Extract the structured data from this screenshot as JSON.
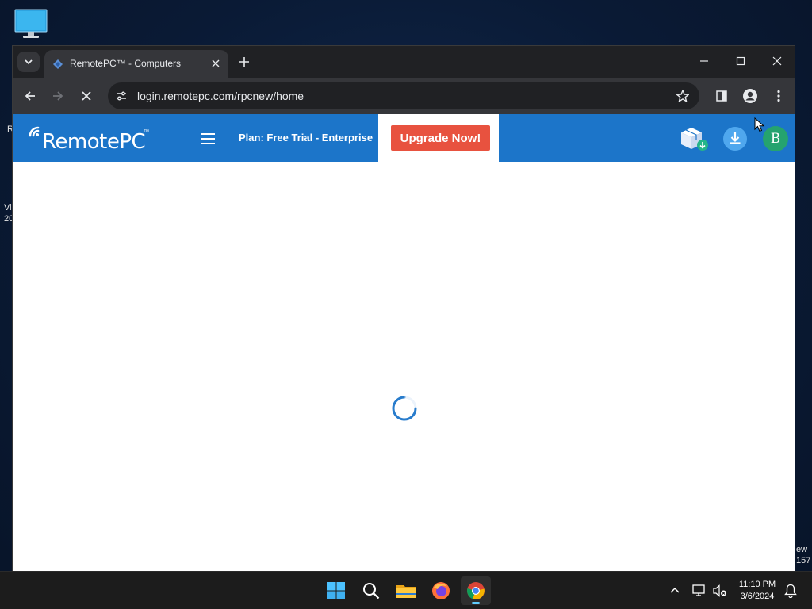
{
  "desktop": {
    "fragments": [
      "R",
      "Vi",
      "20",
      "ew",
      "157"
    ]
  },
  "browser": {
    "tab": {
      "title": "RemotePC™ - Computers"
    },
    "address_bar": {
      "url": "login.remotepc.com/rpcnew/home"
    },
    "icons": {
      "tab_list": "chevron-down-icon",
      "new_tab": "plus-icon",
      "minimize": "minimize-icon",
      "maximize": "maximize-icon",
      "close": "close-icon",
      "back": "back-arrow-icon",
      "forward": "forward-arrow-icon",
      "stop": "stop-loading-icon",
      "site_info": "tune-icon",
      "bookmark": "star-icon",
      "side_panel": "side-panel-icon",
      "profile": "profile-icon",
      "menu": "kebab-menu-icon"
    }
  },
  "page": {
    "header": {
      "brand": "RemotePC",
      "brand_tm": "™",
      "plan": "Plan: Free Trial - Enterprise",
      "upgrade_label": "Upgrade Now!",
      "avatar_initial": "B",
      "colors": {
        "header_bg": "#1c75c9",
        "upgrade_bg": "#e8523f",
        "avatar_bg": "#25a36f"
      }
    },
    "status": "loading"
  },
  "taskbar": {
    "apps": [
      "start-icon",
      "search-icon",
      "file-explorer-icon",
      "firefox-icon",
      "chrome-icon"
    ],
    "active_app": "chrome-icon",
    "clock": {
      "time": "11:10 PM",
      "date": "3/6/2024"
    }
  }
}
